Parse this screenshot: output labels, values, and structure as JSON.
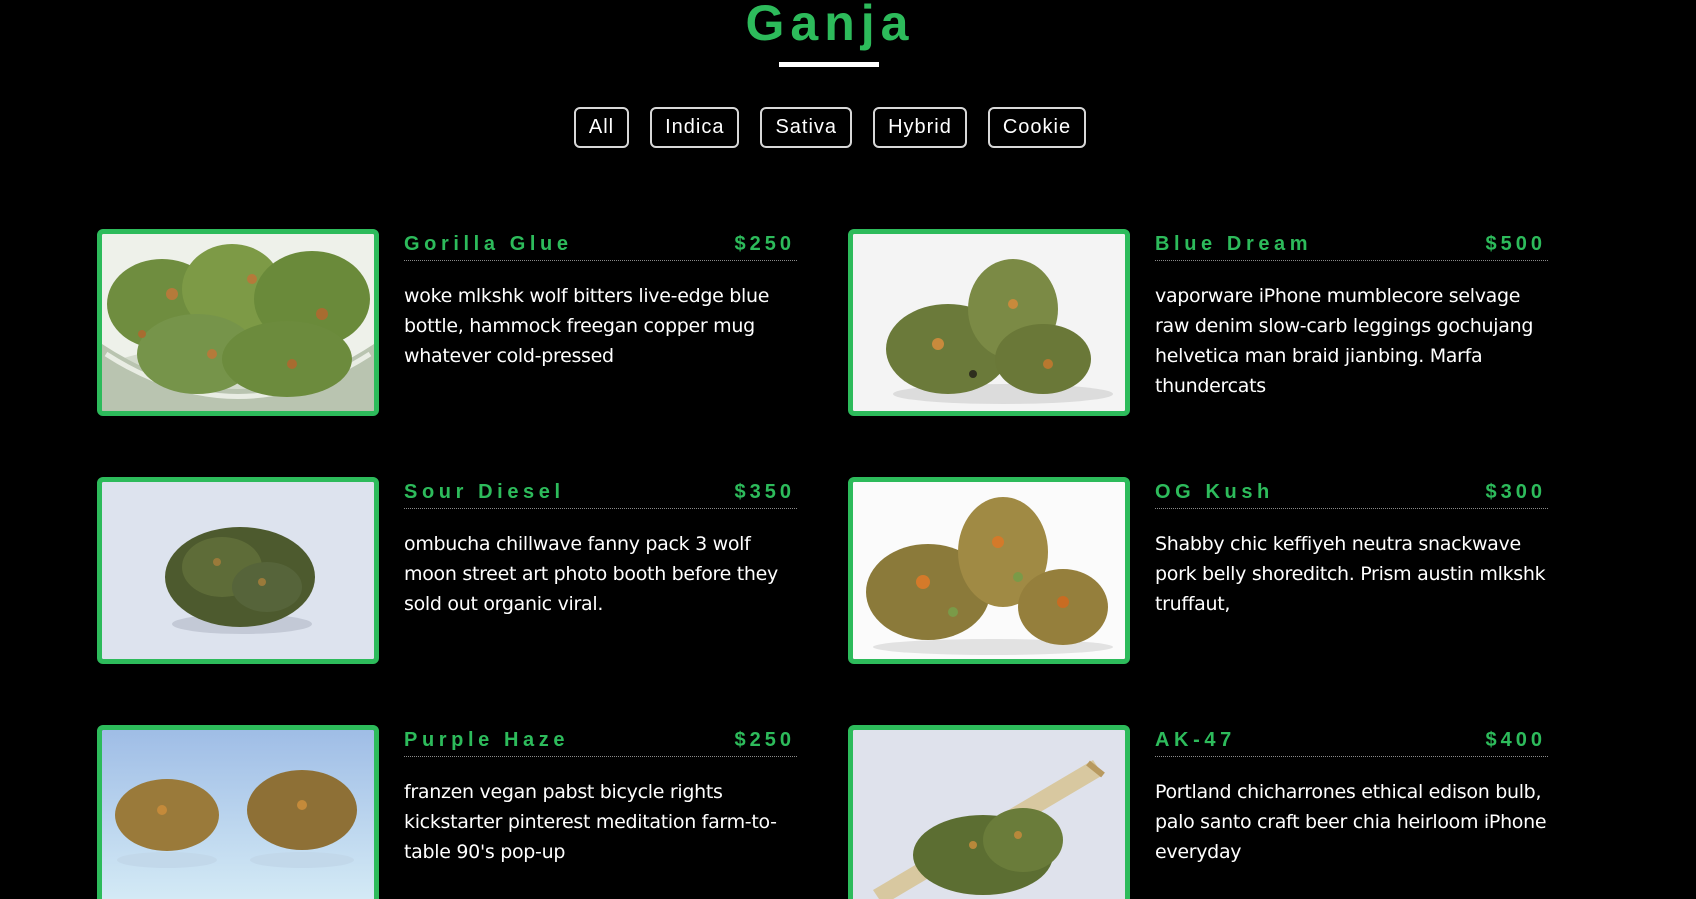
{
  "header": {
    "title": "Ganja"
  },
  "filters": [
    {
      "label": "All"
    },
    {
      "label": "Indica"
    },
    {
      "label": "Sativa"
    },
    {
      "label": "Hybrid"
    },
    {
      "label": "Cookie"
    }
  ],
  "colors": {
    "accent": "#2dbb5b",
    "background": "#000000",
    "text": "#ffffff"
  },
  "menu": {
    "items": [
      {
        "name": "Gorilla Glue",
        "price": "$250",
        "description": "woke mlkshk wolf bitters live-edge blue bottle, hammock freegan copper mug whatever cold-pressed",
        "image": "cannabis-buds-in-jar"
      },
      {
        "name": "Blue Dream",
        "price": "$500",
        "description": "vaporware iPhone mumblecore selvage raw denim slow-carb leggings gochujang helvetica man braid jianbing. Marfa thundercats",
        "image": "cannabis-buds-white-background"
      },
      {
        "name": "Sour Diesel",
        "price": "$350",
        "description": "ombucha chillwave fanny pack 3 wolf moon street art photo booth before they sold out organic viral.",
        "image": "cannabis-bud-grey-background"
      },
      {
        "name": "OG Kush",
        "price": "$300",
        "description": "Shabby chic keffiyeh neutra snackwave pork belly shoreditch. Prism austin mlkshk truffaut,",
        "image": "cannabis-buds-orange-hairs"
      },
      {
        "name": "Purple Haze",
        "price": "$250",
        "description": "franzen vegan pabst bicycle rights kickstarter pinterest meditation farm-to-table 90's pop-up",
        "image": "cannabis-buds-blue-background"
      },
      {
        "name": "AK-47",
        "price": "$400",
        "description": "Portland chicharrones ethical edison bulb, palo santo craft beer chia heirloom iPhone everyday",
        "image": "cannabis-joint-and-bud"
      }
    ]
  }
}
